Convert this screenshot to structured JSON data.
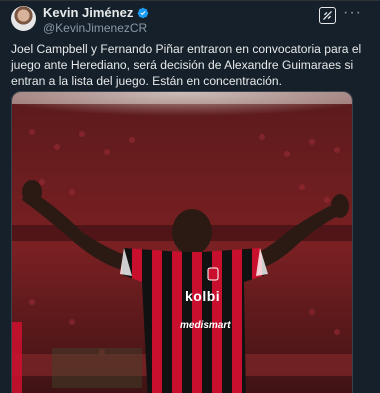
{
  "post": {
    "author_name": "Kevin Jiménez",
    "author_handle": "@KevinJimenezCR",
    "text": "Joel Campbell y Fernando Piñar entraron en convocatoria para el juego ante Herediano, será decisión de Alexandre Guimaraes si entran a la lista del juego. Están en concentración.",
    "media": {
      "shirt_sponsor": "kolbi",
      "shirt_sponsor_2": "medismart"
    }
  },
  "icons": {
    "verified": "verified-badge-icon",
    "grok": "grok-icon",
    "more": "more-options-icon"
  },
  "colors": {
    "background": "#15202b",
    "text": "#e7e9ea",
    "secondary_text": "#8b98a5",
    "verified": "#1d9bf0",
    "jersey_red": "#c8102e",
    "jersey_black": "#111111"
  }
}
